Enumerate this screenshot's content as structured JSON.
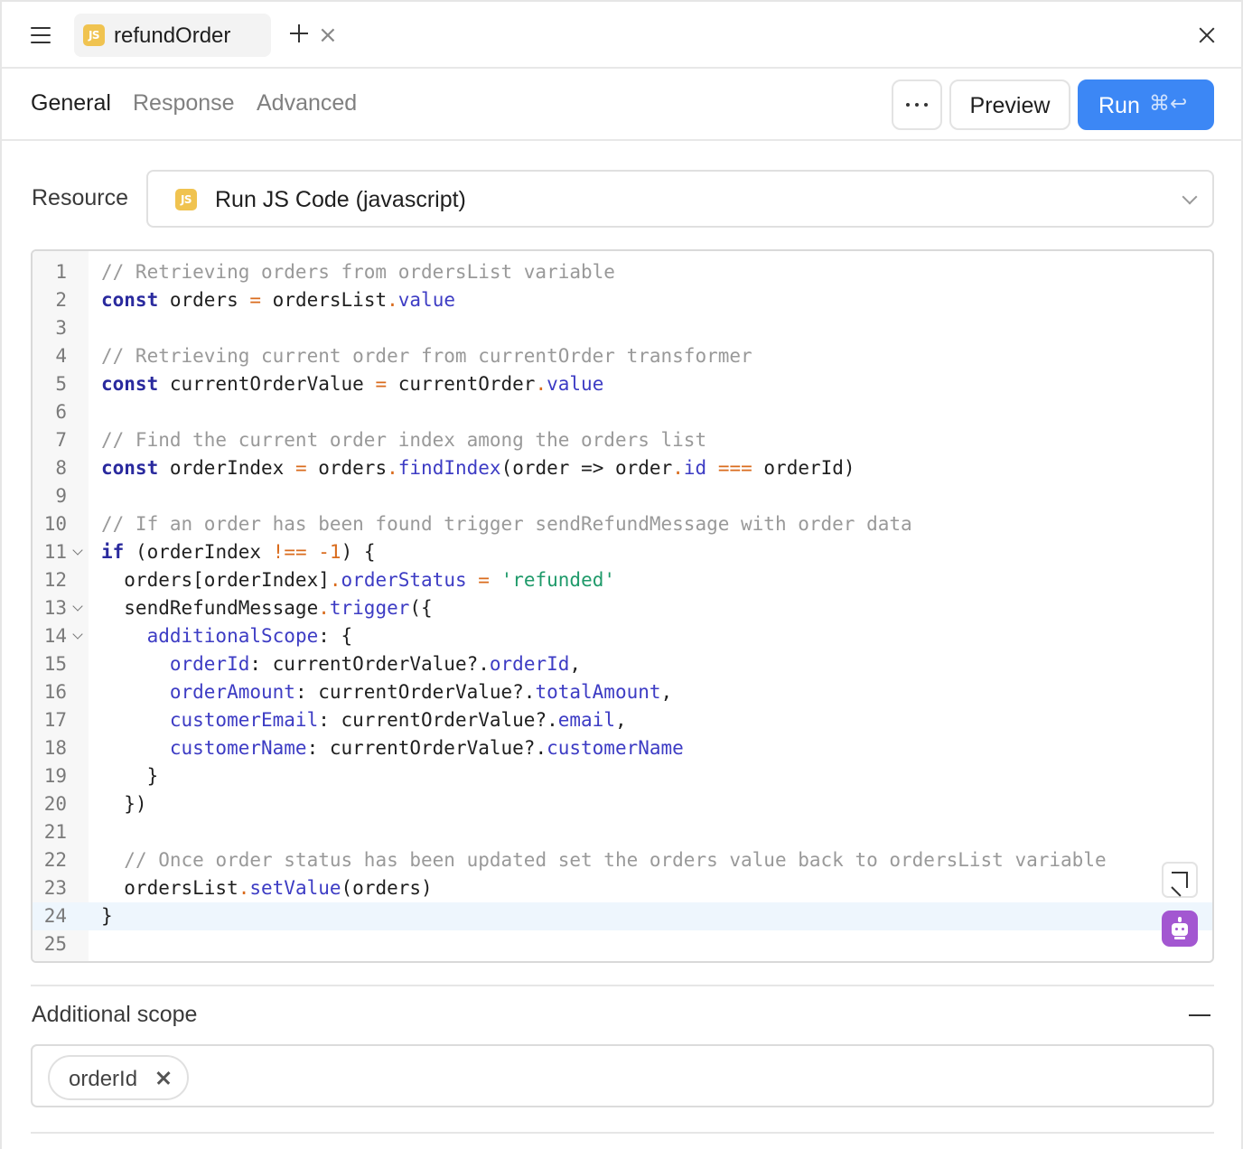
{
  "tabs": {
    "items": [
      {
        "label": "refundOrder",
        "icon": "js-icon",
        "close_glyph": "×"
      }
    ]
  },
  "subtabs": {
    "items": [
      "General",
      "Response",
      "Advanced"
    ],
    "active": "General"
  },
  "actions": {
    "preview_label": "Preview",
    "run_label": "Run",
    "run_shortcut": "⌘↩"
  },
  "resource": {
    "label": "Resource",
    "value": "Run JS Code (javascript)",
    "icon": "js-icon",
    "badge_text": "JS"
  },
  "editor": {
    "active_line": 24,
    "lines": [
      {
        "n": "1",
        "fold": false,
        "tokens": [
          [
            "com",
            "// Retrieving orders from ordersList variable"
          ]
        ]
      },
      {
        "n": "2",
        "fold": false,
        "tokens": [
          [
            "kw",
            "const"
          ],
          [
            "def",
            " orders "
          ],
          [
            "op",
            "="
          ],
          [
            "def",
            " ordersList"
          ],
          [
            "op",
            "."
          ],
          [
            "prop",
            "value"
          ]
        ]
      },
      {
        "n": "3",
        "fold": false,
        "tokens": []
      },
      {
        "n": "4",
        "fold": false,
        "tokens": [
          [
            "com",
            "// Retrieving current order from currentOrder transformer"
          ]
        ]
      },
      {
        "n": "5",
        "fold": false,
        "tokens": [
          [
            "kw",
            "const"
          ],
          [
            "def",
            " currentOrderValue "
          ],
          [
            "op",
            "="
          ],
          [
            "def",
            " currentOrder"
          ],
          [
            "op",
            "."
          ],
          [
            "prop",
            "value"
          ]
        ]
      },
      {
        "n": "6",
        "fold": false,
        "tokens": []
      },
      {
        "n": "7",
        "fold": false,
        "tokens": [
          [
            "com",
            "// Find the current order index among the orders list"
          ]
        ]
      },
      {
        "n": "8",
        "fold": false,
        "tokens": [
          [
            "kw",
            "const"
          ],
          [
            "def",
            " orderIndex "
          ],
          [
            "op",
            "="
          ],
          [
            "def",
            " orders"
          ],
          [
            "op",
            "."
          ],
          [
            "prop",
            "findIndex"
          ],
          [
            "def",
            "(order => order"
          ],
          [
            "op",
            "."
          ],
          [
            "prop",
            "id"
          ],
          [
            "def",
            " "
          ],
          [
            "op",
            "==="
          ],
          [
            "def",
            " orderId)"
          ]
        ]
      },
      {
        "n": "9",
        "fold": false,
        "tokens": []
      },
      {
        "n": "10",
        "fold": false,
        "tokens": [
          [
            "com",
            "// If an order has been found trigger sendRefundMessage with order data"
          ]
        ]
      },
      {
        "n": "11",
        "fold": true,
        "tokens": [
          [
            "kw",
            "if"
          ],
          [
            "def",
            " (orderIndex "
          ],
          [
            "op",
            "!=="
          ],
          [
            "def",
            " "
          ],
          [
            "num",
            "-1"
          ],
          [
            "def",
            ") {"
          ]
        ]
      },
      {
        "n": "12",
        "fold": false,
        "tokens": [
          [
            "def",
            "  orders[orderIndex]"
          ],
          [
            "op",
            "."
          ],
          [
            "prop",
            "orderStatus"
          ],
          [
            "def",
            " "
          ],
          [
            "op",
            "="
          ],
          [
            "def",
            " "
          ],
          [
            "str",
            "'refunded'"
          ]
        ]
      },
      {
        "n": "13",
        "fold": true,
        "tokens": [
          [
            "def",
            "  sendRefundMessage"
          ],
          [
            "op",
            "."
          ],
          [
            "prop",
            "trigger"
          ],
          [
            "def",
            "({"
          ]
        ]
      },
      {
        "n": "14",
        "fold": true,
        "tokens": [
          [
            "def",
            "    "
          ],
          [
            "prop",
            "additionalScope"
          ],
          [
            "def",
            ": {"
          ]
        ]
      },
      {
        "n": "15",
        "fold": false,
        "tokens": [
          [
            "def",
            "      "
          ],
          [
            "prop",
            "orderId"
          ],
          [
            "def",
            ": currentOrderValue?."
          ],
          [
            "prop",
            "orderId"
          ],
          [
            "def",
            ","
          ]
        ]
      },
      {
        "n": "16",
        "fold": false,
        "tokens": [
          [
            "def",
            "      "
          ],
          [
            "prop",
            "orderAmount"
          ],
          [
            "def",
            ": currentOrderValue?."
          ],
          [
            "prop",
            "totalAmount"
          ],
          [
            "def",
            ","
          ]
        ]
      },
      {
        "n": "17",
        "fold": false,
        "tokens": [
          [
            "def",
            "      "
          ],
          [
            "prop",
            "customerEmail"
          ],
          [
            "def",
            ": currentOrderValue?."
          ],
          [
            "prop",
            "email"
          ],
          [
            "def",
            ","
          ]
        ]
      },
      {
        "n": "18",
        "fold": false,
        "tokens": [
          [
            "def",
            "      "
          ],
          [
            "prop",
            "customerName"
          ],
          [
            "def",
            ": currentOrderValue?."
          ],
          [
            "prop",
            "customerName"
          ]
        ]
      },
      {
        "n": "19",
        "fold": false,
        "tokens": [
          [
            "def",
            "    }"
          ]
        ]
      },
      {
        "n": "20",
        "fold": false,
        "tokens": [
          [
            "def",
            "  })"
          ]
        ]
      },
      {
        "n": "21",
        "fold": false,
        "tokens": []
      },
      {
        "n": "22",
        "fold": false,
        "tokens": [
          [
            "def",
            "  "
          ],
          [
            "com",
            "// Once order status has been updated set the orders value back to ordersList variable"
          ]
        ]
      },
      {
        "n": "23",
        "fold": false,
        "tokens": [
          [
            "def",
            "  ordersList"
          ],
          [
            "op",
            "."
          ],
          [
            "prop",
            "setValue"
          ],
          [
            "def",
            "(orders)"
          ]
        ]
      },
      {
        "n": "24",
        "fold": false,
        "tokens": [
          [
            "def",
            "}"
          ]
        ]
      },
      {
        "n": "25",
        "fold": false,
        "tokens": []
      }
    ]
  },
  "additional_scope": {
    "title": "Additional scope",
    "chips": [
      "orderId"
    ]
  },
  "colors": {
    "accent": "#3c87f5",
    "js_badge": "#f0c350",
    "assistant": "#a357d1",
    "keyword": "#2a2a9e",
    "property": "#3d3cc4",
    "operator": "#d96b1c",
    "string": "#1f9a6a",
    "comment": "#999999"
  }
}
